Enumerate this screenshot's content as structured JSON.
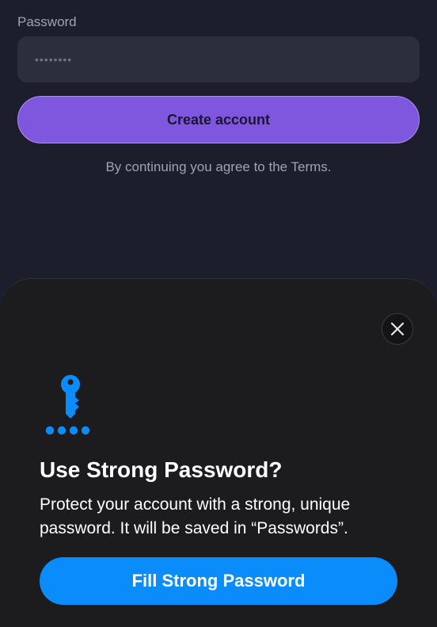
{
  "form": {
    "password_label": "Password",
    "password_value": "••••••••",
    "create_button_label": "Create account",
    "terms_text": "By continuing you agree to the Terms."
  },
  "sheet": {
    "close_icon": "close-icon",
    "key_icon": "key-icon",
    "title": "Use Strong Password?",
    "description": "Protect your account with a strong, unique password. It will be saved in “Passwords”.",
    "fill_button_label": "Fill Strong Password"
  },
  "colors": {
    "background": "#1c1e2b",
    "input_background": "#2b2f3d",
    "create_button": "#7f57de",
    "sheet_background": "#1c1c1f",
    "accent_blue": "#0a8cfb"
  }
}
